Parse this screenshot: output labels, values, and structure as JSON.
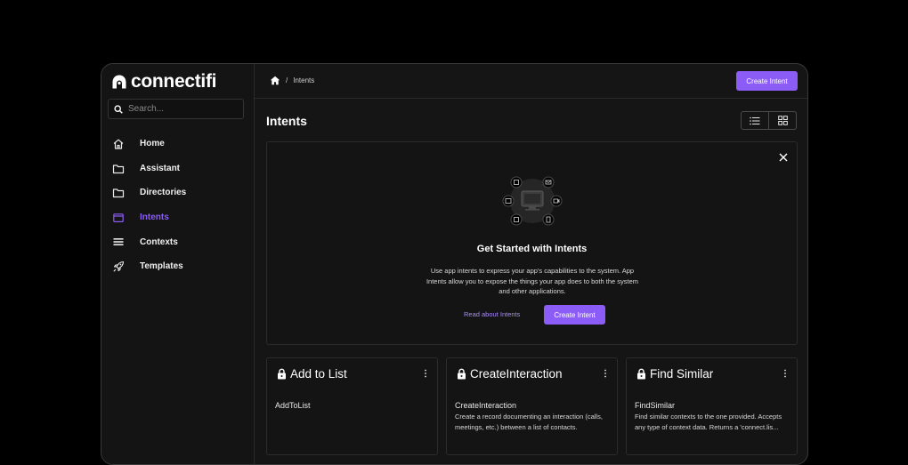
{
  "brand": {
    "name": "connectifi"
  },
  "search": {
    "placeholder": "Search..."
  },
  "sidebar": {
    "items": [
      {
        "label": "Home",
        "icon": "home-icon",
        "active": false
      },
      {
        "label": "Assistant",
        "icon": "folder-icon",
        "active": false
      },
      {
        "label": "Directories",
        "icon": "folder-icon",
        "active": false
      },
      {
        "label": "Intents",
        "icon": "window-icon",
        "active": true
      },
      {
        "label": "Contexts",
        "icon": "stack-icon",
        "active": false
      },
      {
        "label": "Templates",
        "icon": "rocket-icon",
        "active": false
      }
    ]
  },
  "breadcrumb": {
    "separator": "/",
    "current": "Intents"
  },
  "header": {
    "create_button": "Create Intent"
  },
  "page": {
    "title": "Intents"
  },
  "empty_state": {
    "title": "Get Started with Intents",
    "description": "Use app intents to express your app's capabilities to the system. App Intents allow you to expose the things your app does to both the system and other applications.",
    "link": "Read about Intents",
    "button": "Create Intent"
  },
  "cards": [
    {
      "title": "Add to List",
      "subtitle": "AddToList",
      "description": ""
    },
    {
      "title": "CreateInteraction",
      "subtitle": "CreateInteraction",
      "description": "Create a record documenting an interaction (calls, meetings, etc.) between a list of contacts."
    },
    {
      "title": "Find Similar",
      "subtitle": "FindSimilar",
      "description": "Find similar contexts to the one provided. Accepts any type of context data. Returns a 'connect.lis..."
    }
  ],
  "colors": {
    "accent": "#8b5cf6",
    "background": "#151515",
    "border": "#2c2c2c"
  }
}
